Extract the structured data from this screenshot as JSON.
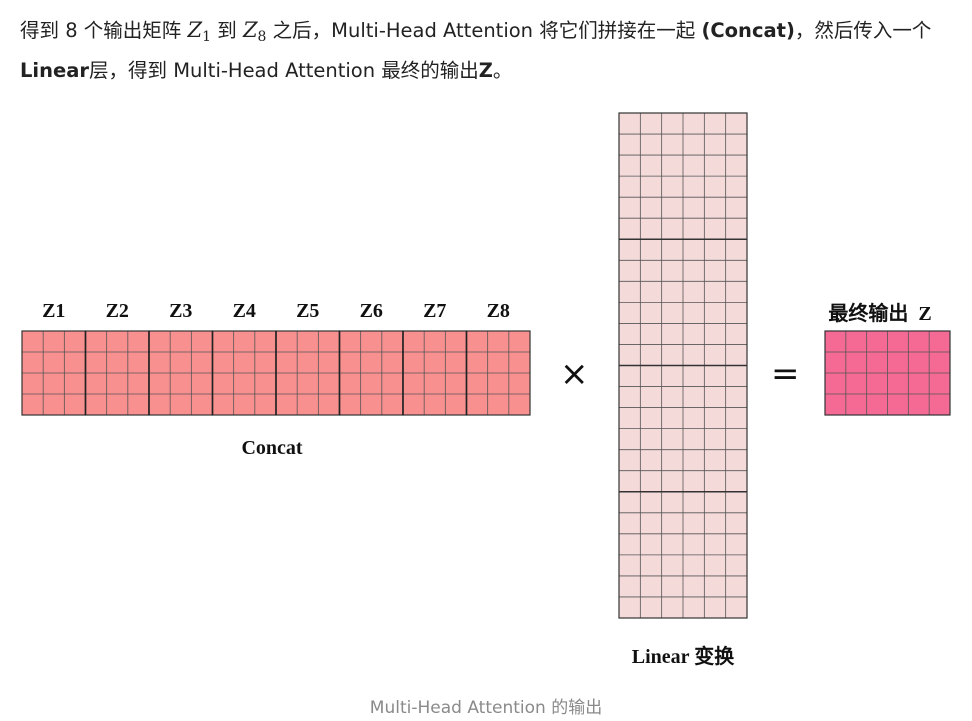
{
  "intro": {
    "p1": "得到 8 个输出矩阵 ",
    "z1_base": "Z",
    "z1_sub": "1",
    "p2": " 到 ",
    "z8_base": "Z",
    "z8_sub": "8",
    "p3": " 之后，Multi-Head Attention 将它们拼接在一起 ",
    "concat_bold": "(Concat)",
    "p4": "，然后传入一个",
    "linear_bold": "Linear",
    "p5": "层，得到 Multi-Head Attention 最终的输出",
    "z_bold": "Z",
    "p6": "。"
  },
  "diagram": {
    "z_labels": [
      "Z1",
      "Z2",
      "Z3",
      "Z4",
      "Z5",
      "Z6",
      "Z7",
      "Z8"
    ],
    "concat_label": "Concat",
    "times_symbol": "×",
    "equals_symbol": "=",
    "linear_label": "Linear 变换",
    "output_label": "最终输出  Z",
    "colors": {
      "concat_fill": "#f99090",
      "weight_fill": "#f5dada",
      "output_fill": "#f46a95",
      "grid_line": "#555555"
    }
  },
  "caption": "Multi-Head Attention 的输出"
}
